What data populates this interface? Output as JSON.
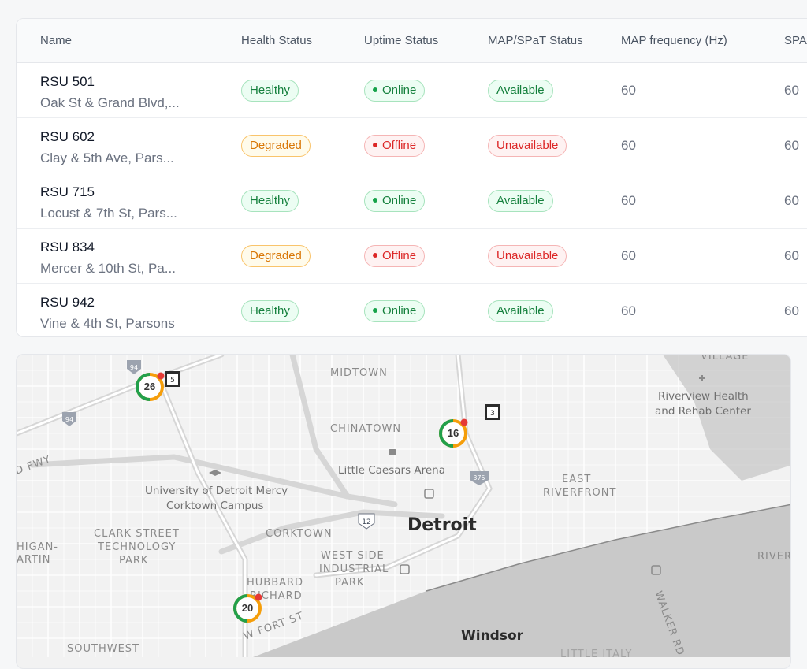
{
  "table": {
    "headers": [
      "Name",
      "Health Status",
      "Uptime Status",
      "MAP/SPaT Status",
      "MAP frequency (Hz)",
      "SPA"
    ],
    "rows": [
      {
        "name": "RSU 501",
        "address": "Oak St & Grand Blvd,...",
        "health": "Healthy",
        "uptime": "Online",
        "mapspat": "Available",
        "map_freq": "60",
        "spat_freq": "60"
      },
      {
        "name": "RSU 602",
        "address": "Clay & 5th Ave, Pars...",
        "health": "Degraded",
        "uptime": "Offline",
        "mapspat": "Unavailable",
        "map_freq": "60",
        "spat_freq": "60"
      },
      {
        "name": "RSU 715",
        "address": "Locust & 7th St, Pars...",
        "health": "Healthy",
        "uptime": "Online",
        "mapspat": "Available",
        "map_freq": "60",
        "spat_freq": "60"
      },
      {
        "name": "RSU 834",
        "address": "Mercer & 10th St, Pa...",
        "health": "Degraded",
        "uptime": "Offline",
        "mapspat": "Unavailable",
        "map_freq": "60",
        "spat_freq": "60"
      },
      {
        "name": "RSU 942",
        "address": "Vine & 4th St, Parsons",
        "health": "Healthy",
        "uptime": "Online",
        "mapspat": "Available",
        "map_freq": "60",
        "spat_freq": "60"
      }
    ]
  },
  "map": {
    "labels": {
      "midtown": "MIDTOWN",
      "chinatown": "CHINATOWN",
      "village": "VILLAGE",
      "east_riverfront": "EAST",
      "east_riverfront_2": "RIVERFRONT",
      "clark_1": "CLARK STREET",
      "clark_2": "TECHNOLOGY",
      "clark_3": "PARK",
      "corktown": "CORKTOWN",
      "westside_1": "WEST SIDE",
      "westside_2": "INDUSTRIAL",
      "westside_3": "PARK",
      "hubbard_1": "HUBBARD",
      "hubbard_2": "RICHARD",
      "southwest": "SOUTHWEST",
      "michigan": "HIGAN-",
      "martin": "ARTIN",
      "river": "RIVER",
      "walker": "WALKER RD",
      "little_italy": "LITTLE ITALY",
      "fwy": "D FWY",
      "w_fort": "W FORT ST"
    },
    "pois": {
      "riverview_1": "Riverview Health",
      "riverview_2": "and Rehab Center",
      "arena": "Little Caesars Arena",
      "udm_1": "University of Detroit Mercy",
      "udm_2": "Corktown Campus"
    },
    "cities": {
      "detroit": "Detroit",
      "windsor": "Windsor"
    },
    "shields": {
      "i94_a": "94",
      "i94_b": "94",
      "i375": "375",
      "us12": "12",
      "rt5": "5",
      "rt3": "3"
    },
    "clusters": [
      {
        "count": "26",
        "healthy_fraction": 0.5
      },
      {
        "count": "16",
        "healthy_fraction": 0.5
      },
      {
        "count": "20",
        "healthy_fraction": 0.5
      }
    ],
    "colors": {
      "healthy": "#22a04b",
      "degraded": "#f59e0b",
      "offline": "#e53935",
      "water": "#c9c9c9"
    }
  }
}
